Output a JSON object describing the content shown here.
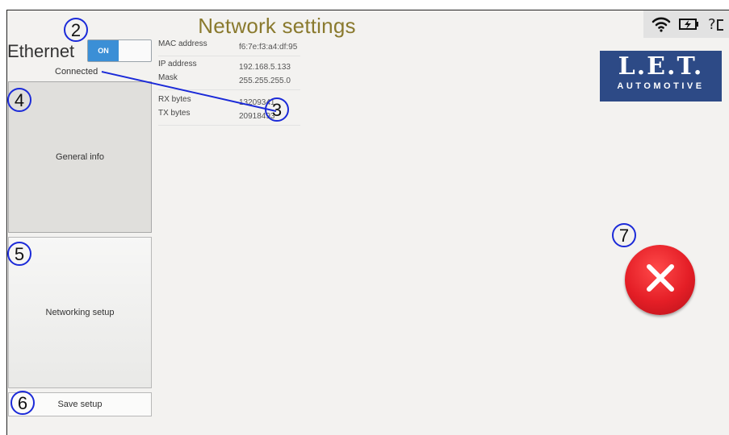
{
  "title": "Network settings",
  "status_icons": [
    "wifi-icon",
    "battery-charging-icon",
    "help-icon"
  ],
  "status_question": "?",
  "ethernet": {
    "label": "Ethernet",
    "toggle_state": "ON",
    "status": "Connected"
  },
  "tiles": {
    "general": "General info",
    "network": "Networking setup",
    "save": "Save setup"
  },
  "info": [
    {
      "key": "MAC address",
      "value": "f6:7e:f3:a4:df:95"
    },
    {
      "key": "IP address",
      "value": "192.168.5.133"
    },
    {
      "key": "Mask",
      "value": "255.255.255.0"
    },
    {
      "key": "RX bytes",
      "value": "13209341"
    },
    {
      "key": "TX bytes",
      "value": "20918493"
    }
  ],
  "logo": {
    "line1": "L.E.T.",
    "line2": "AUTOMOTIVE"
  },
  "annotations": [
    "2",
    "3",
    "4",
    "5",
    "6",
    "7"
  ],
  "colors": {
    "accent": "#3b8fd6",
    "title": "#8a7a2e",
    "logo_bg": "#2d4a86",
    "close": "#e41e26",
    "annotation": "#1b2ad8"
  }
}
